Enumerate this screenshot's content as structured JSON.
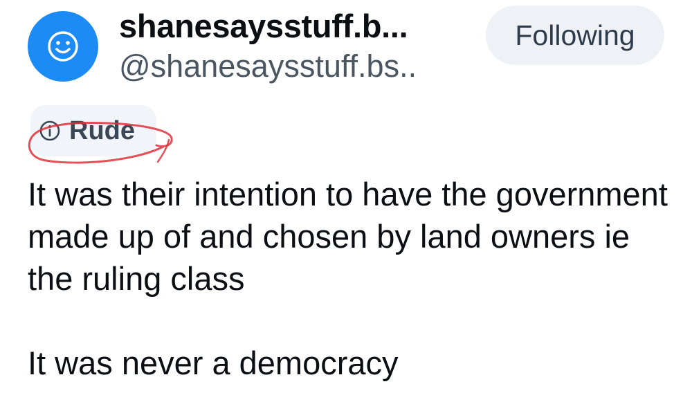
{
  "author": {
    "display_name": "shanesaysstuff.b...",
    "handle": "@shanesaysstuff.bs..",
    "avatar_icon": "smiley-face-icon",
    "avatar_color": "#1d8bf5"
  },
  "follow_button": {
    "label": "Following"
  },
  "content_label": {
    "icon": "info-circle-icon",
    "text": "Rude"
  },
  "annotation": {
    "type": "hand-drawn-circle",
    "color": "#e0303a"
  },
  "post": {
    "paragraphs": [
      "It was their intention to have the government made up of and chosen by land owners ie the ruling class",
      "It was never a democracy"
    ]
  }
}
